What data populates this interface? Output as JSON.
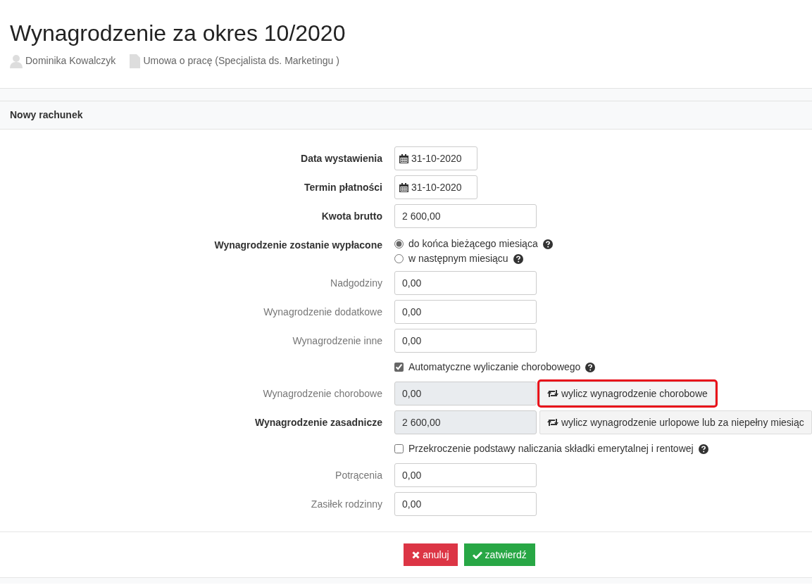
{
  "title": "Wynagrodzenie za okres 10/2020",
  "meta": [
    {
      "kind": "person",
      "text": "Dominika Kowalczyk"
    },
    {
      "kind": "document",
      "text": "Umowa o pracę (Specjalista ds. Marketingu )"
    }
  ],
  "section_title": "Nowy rachunek",
  "rows": [
    {
      "kind": "date",
      "label": "Data wystawienia",
      "bold": true,
      "value": "31-10-2020"
    },
    {
      "kind": "date",
      "label": "Termin płatności",
      "bold": true,
      "value": "31-10-2020"
    },
    {
      "kind": "text",
      "label": "Kwota brutto",
      "bold": true,
      "value": "2 600,00"
    },
    {
      "kind": "radio",
      "label": "Wynagrodzenie zostanie wypłacone",
      "bold": true,
      "options": [
        {
          "label": "do końca bieżącego miesiąca",
          "selected": true
        },
        {
          "label": "w następnym miesiącu",
          "selected": false
        }
      ]
    },
    {
      "kind": "text",
      "label": "Nadgodziny",
      "bold": false,
      "value": "0,00"
    },
    {
      "kind": "text",
      "label": "Wynagrodzenie dodatkowe",
      "bold": false,
      "value": "0,00"
    },
    {
      "kind": "text",
      "label": "Wynagrodzenie inne",
      "bold": false,
      "value": "0,00"
    },
    {
      "kind": "checkbox",
      "text": "Automatyczne wyliczanie chorobowego",
      "checked": true
    },
    {
      "kind": "readonly",
      "label": "Wynagrodzenie chorobowe",
      "bold": false,
      "value": "0,00",
      "button": "wylicz wynagrodzenie chorobowe",
      "highlighted": true
    },
    {
      "kind": "readonly",
      "label": "Wynagrodzenie zasadnicze",
      "bold": true,
      "value": "2 600,00",
      "button": "wylicz wynagrodzenie urlopowe lub za niepełny miesiąc",
      "highlighted": false
    },
    {
      "kind": "checkbox",
      "text": "Przekroczenie podstawy naliczania składki emerytalnej i rentowej",
      "checked": false
    },
    {
      "kind": "text",
      "label": "Potrącenia",
      "bold": false,
      "value": "0,00"
    },
    {
      "kind": "text",
      "label": "Zasiłek rodzinny",
      "bold": false,
      "value": "0,00"
    }
  ],
  "actions": [
    {
      "kind": "cancel",
      "label": "anuluj"
    },
    {
      "kind": "confirm",
      "label": "zatwierdź"
    }
  ]
}
